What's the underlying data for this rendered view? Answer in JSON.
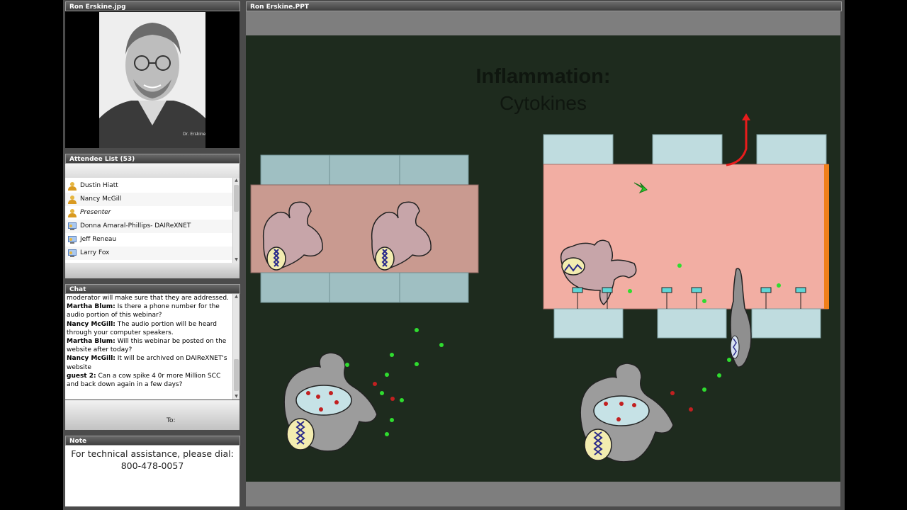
{
  "presenter_panel": {
    "title": "Ron Erskine.jpg",
    "photo_icon": "presenter-photo"
  },
  "attendees": {
    "title": "Attendee List (53)",
    "items": [
      {
        "name": "Dustin Hiatt",
        "role": "host",
        "icon": "host-user-icon"
      },
      {
        "name": "Nancy McGill",
        "role": "host",
        "icon": "host-user-icon"
      },
      {
        "name": "Presenter",
        "role": "presenter",
        "icon": "host-user-icon"
      },
      {
        "name": "Donna Amaral-Phillips- DAIReXNET",
        "role": "attendee",
        "icon": "attendee-icon"
      },
      {
        "name": "Jeff Reneau",
        "role": "attendee",
        "icon": "attendee-icon"
      },
      {
        "name": "Larry Fox",
        "role": "attendee",
        "icon": "attendee-icon"
      }
    ]
  },
  "chat": {
    "title": "Chat",
    "messages": [
      {
        "author": "",
        "text": "moderator will make sure that they are addressed."
      },
      {
        "author": "Martha Blum:",
        "text": " Is there a phone number for the audio portion of this webinar?"
      },
      {
        "author": "Nancy McGill:",
        "text": " The audio portion will be heard through your computer speakers."
      },
      {
        "author": "Martha Blum:",
        "text": " Will this webinar be posted on the website after today?"
      },
      {
        "author": "Nancy McGill:",
        "text": " It will be archived on DAIReXNET's website"
      },
      {
        "author": "guest 2:",
        "text": " Can a cow spike 4 0r more Million SCC and back down again in a few days?"
      }
    ],
    "to_label": "To:"
  },
  "note": {
    "title": "Note",
    "line1": "For technical assistance, please dial:",
    "line2": "800-478-0057"
  },
  "slide": {
    "panel_title": "Ron Erskine.PPT",
    "title_line1": "Inflammation:",
    "title_line2": "Cytokines"
  },
  "colors": {
    "slide_bg": "#1e2b1e",
    "tissue_left": "#c99a90",
    "tissue_right": "#f2aea3",
    "endothelium": "#9fbfc2",
    "cytokine_dot": "#2fdc2f",
    "arrow_red": "#e81c1c",
    "arrow_green": "#28c828",
    "edge_orange": "#f07f1a"
  }
}
